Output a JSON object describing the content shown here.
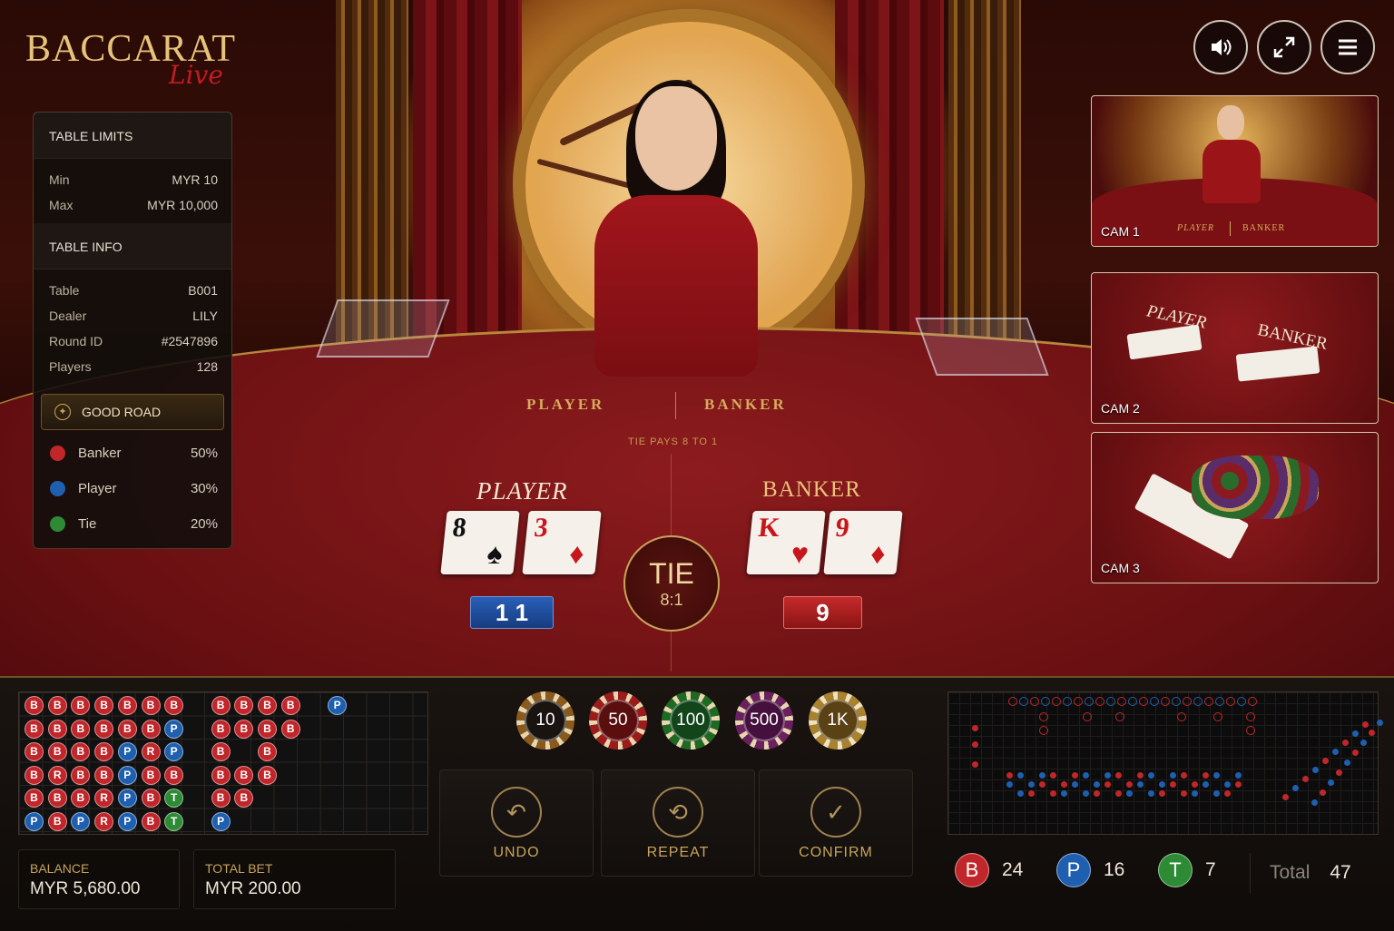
{
  "brand": {
    "title": "BACCARAT",
    "subtitle": "Live"
  },
  "table_limits": {
    "heading": "TABLE LIMITS",
    "rows": [
      {
        "label": "Min",
        "value": "MYR 10"
      },
      {
        "label": "Max",
        "value": "MYR 10,000"
      }
    ]
  },
  "table_info": {
    "heading": "TABLE INFO",
    "rows": [
      {
        "label": "Table",
        "value": "B001"
      },
      {
        "label": "Dealer",
        "value": "LILY"
      },
      {
        "label": "Round ID",
        "value": "#2547896"
      },
      {
        "label": "Players",
        "value": "128"
      }
    ]
  },
  "good_road": {
    "label": "GOOD ROAD",
    "items": [
      {
        "label": "Banker",
        "value": "50%",
        "color": "#c0262a"
      },
      {
        "label": "Player",
        "value": "30%",
        "color": "#1e5fb0"
      },
      {
        "label": "Tie",
        "value": "20%",
        "color": "#2e8b35"
      }
    ]
  },
  "top_controls": [
    {
      "name": "volume-button",
      "icon": "volume-icon"
    },
    {
      "name": "fullscreen-button",
      "icon": "fullscreen-icon"
    },
    {
      "name": "menu-button",
      "icon": "menu-icon"
    }
  ],
  "cameras": [
    {
      "label": "CAM 1"
    },
    {
      "label": "CAM 2"
    },
    {
      "label": "CAM 3"
    }
  ],
  "felt": {
    "player": "PLAYER",
    "banker": "BANKER",
    "tie_pays": "TIE PAYS 8 TO 1"
  },
  "cam1_felt": {
    "player": "PLAYER",
    "banker": "BANKER"
  },
  "cam2_felt": {
    "player": "PLAYER",
    "banker": "BANKER"
  },
  "game": {
    "player": {
      "label": "PLAYER",
      "cards": [
        {
          "rank": "8",
          "suit": "♠",
          "color": "#111"
        },
        {
          "rank": "3",
          "suit": "♦",
          "color": "#c8161d"
        }
      ],
      "score": "1 1"
    },
    "banker": {
      "label": "BANKER",
      "cards": [
        {
          "rank": "K",
          "suit": "♥",
          "color": "#c8161d"
        },
        {
          "rank": "9",
          "suit": "♦",
          "color": "#c8161d"
        }
      ],
      "score": "9"
    },
    "tie": {
      "label": "TIE",
      "odds": "8:1"
    }
  },
  "chips": [
    {
      "value": "10",
      "color": "#8a5a1c"
    },
    {
      "value": "50",
      "color": "#9c1c1c"
    },
    {
      "value": "100",
      "color": "#1f6a22"
    },
    {
      "value": "500",
      "color": "#6a1f5e"
    },
    {
      "value": "1K",
      "color": "#a8822e"
    }
  ],
  "actions": {
    "undo": "UNDO",
    "repeat": "REPEAT",
    "confirm": "CONFIRM"
  },
  "balance": {
    "label": "BALANCE",
    "value": "MYR 5,680.00"
  },
  "total_bet": {
    "label": "TOTAL BET",
    "value": "MYR 200.00"
  },
  "stats": {
    "banker": {
      "letter": "B",
      "count": "24"
    },
    "player": {
      "letter": "P",
      "count": "16"
    },
    "tie": {
      "letter": "T",
      "count": "7"
    },
    "total": {
      "label": "Total",
      "count": "47"
    }
  },
  "bead_road": [
    [
      "B",
      "B",
      "B",
      "B",
      "B",
      "B",
      "B",
      "",
      "B",
      "B",
      "B",
      "B",
      "",
      "P"
    ],
    [
      "B",
      "B",
      "B",
      "B",
      "B",
      "B",
      "P",
      "",
      "B",
      "B",
      "B",
      "B"
    ],
    [
      "B",
      "B",
      "B",
      "B",
      "P",
      "R",
      "P",
      "",
      "B",
      "",
      "B"
    ],
    [
      "B",
      "R",
      "B",
      "B",
      "P",
      "B",
      "B",
      "",
      "B",
      "B",
      "B"
    ],
    [
      "B",
      "B",
      "B",
      "R",
      "P",
      "B",
      "T",
      "",
      "B",
      "B"
    ],
    [
      "P",
      "B",
      "P",
      "R",
      "P",
      "B",
      "T",
      "",
      "P"
    ]
  ],
  "colors": {
    "banker": "#c0262a",
    "player": "#1e5fb0",
    "tie": "#2e8b35",
    "gold": "#c9a458"
  }
}
